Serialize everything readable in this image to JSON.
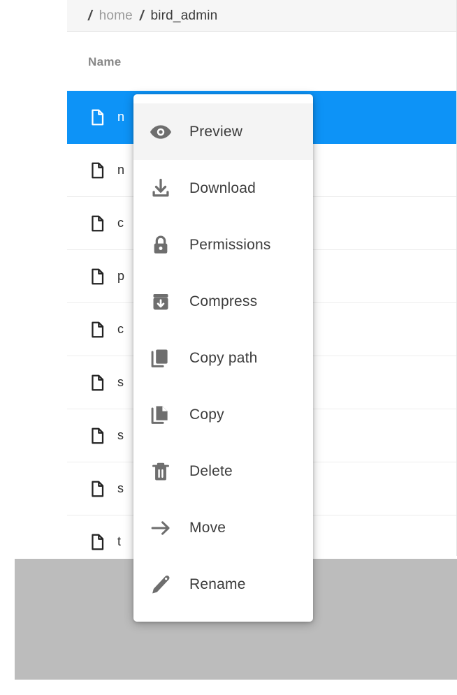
{
  "breadcrumb": {
    "separator": "/",
    "items": [
      {
        "label": "home",
        "current": false
      },
      {
        "label": "bird_admin",
        "current": true
      }
    ]
  },
  "file_list": {
    "columns": [
      "Name"
    ],
    "rows": [
      {
        "name": "n",
        "icon": "file-icon",
        "selected": true
      },
      {
        "name": "n",
        "icon": "file-icon",
        "selected": false
      },
      {
        "name": "c",
        "icon": "file-icon",
        "selected": false
      },
      {
        "name": "p",
        "icon": "file-icon",
        "selected": false
      },
      {
        "name": "c",
        "icon": "file-icon",
        "selected": false
      },
      {
        "name": "s",
        "icon": "file-icon",
        "selected": false
      },
      {
        "name": "s",
        "icon": "file-icon",
        "selected": false
      },
      {
        "name": "s",
        "icon": "file-icon",
        "selected": false
      },
      {
        "name": "t",
        "icon": "file-icon",
        "selected": false
      }
    ]
  },
  "context_menu": {
    "items": [
      {
        "label": "Preview",
        "icon": "eye-icon",
        "hovered": true
      },
      {
        "label": "Download",
        "icon": "download-icon",
        "hovered": false
      },
      {
        "label": "Permissions",
        "icon": "lock-icon",
        "hovered": false
      },
      {
        "label": "Compress",
        "icon": "archive-down-icon",
        "hovered": false
      },
      {
        "label": "Copy path",
        "icon": "copy-path-icon",
        "hovered": false
      },
      {
        "label": "Copy",
        "icon": "copy-file-icon",
        "hovered": false
      },
      {
        "label": "Delete",
        "icon": "trash-icon",
        "hovered": false
      },
      {
        "label": "Move",
        "icon": "arrow-right-icon",
        "hovered": false
      },
      {
        "label": "Rename",
        "icon": "pencil-icon",
        "hovered": false
      }
    ]
  },
  "colors": {
    "selection_blue": "#0d93f7",
    "menu_hover": "#f4f4f4",
    "breadcrumb_bg": "#f6f6f6",
    "overlay_gray": "#bcbcbc",
    "icon_gray": "#6e6e6e",
    "row_divider": "#ededed"
  }
}
